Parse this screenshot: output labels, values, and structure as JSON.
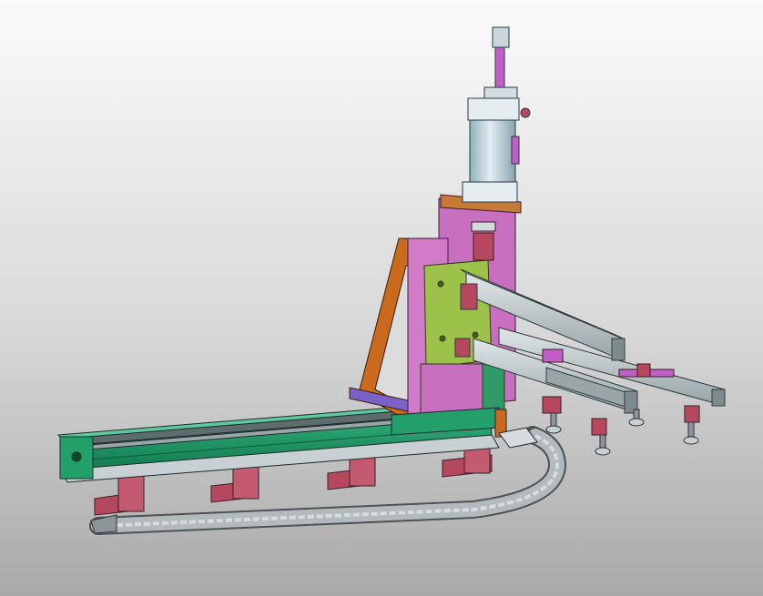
{
  "scene": {
    "subject": "",
    "colors": {
      "background_top": "#fbfbfb",
      "background_bottom": "#a9a9a9",
      "cylinder": "#b9d3dc",
      "piston_rod": "#c05fc7",
      "frame_plate": "#c86fc0",
      "mounting_plate": "#9cc24a",
      "bracket": "#c96a1e",
      "rail_green": "#1f9f6a",
      "rail_silver": "#b8c2c4",
      "feet": "#b5475f",
      "cable_chain": "#a9b1b4",
      "profile": "#b9c2c4"
    }
  }
}
